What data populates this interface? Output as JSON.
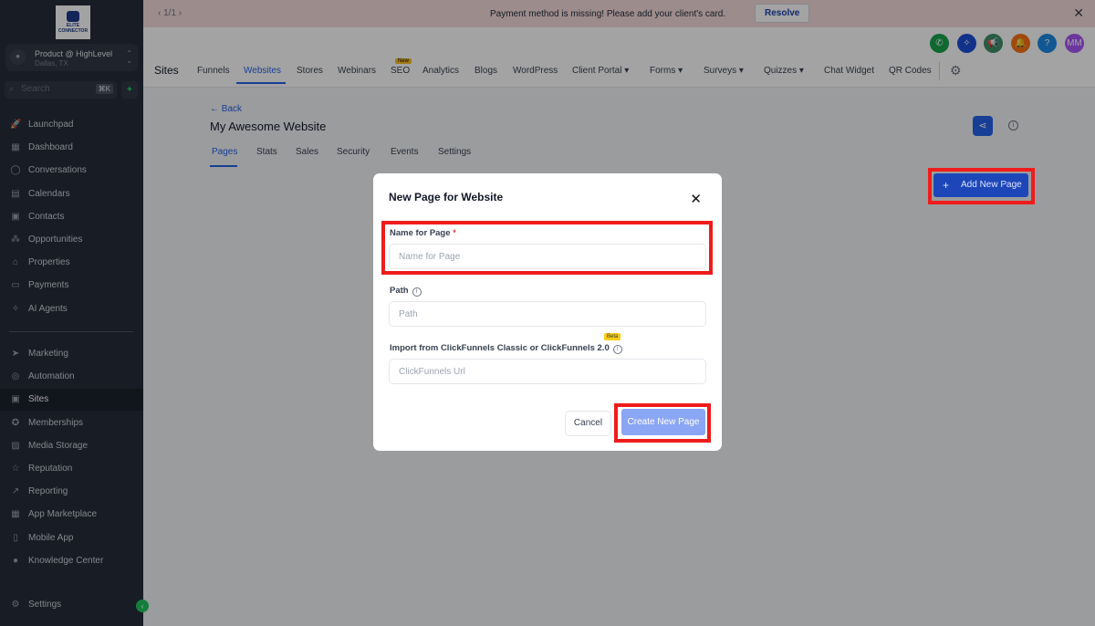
{
  "sidebar": {
    "logo_text": "ELITE CONNECTOR",
    "account_name": "Product @ HighLevel",
    "account_location": "Dallas, TX",
    "search_placeholder": "Search",
    "search_shortcut": "⌘K",
    "items": [
      {
        "label": "Launchpad",
        "icon": "rocket-icon"
      },
      {
        "label": "Dashboard",
        "icon": "grid-icon"
      },
      {
        "label": "Conversations",
        "icon": "chat-icon"
      },
      {
        "label": "Calendars",
        "icon": "calendar-icon"
      },
      {
        "label": "Contacts",
        "icon": "contacts-icon"
      },
      {
        "label": "Opportunities",
        "icon": "funnel-icon"
      },
      {
        "label": "Properties",
        "icon": "home-icon"
      },
      {
        "label": "Payments",
        "icon": "card-icon"
      },
      {
        "label": "AI Agents",
        "icon": "sparkle-icon"
      }
    ],
    "items2": [
      {
        "label": "Marketing",
        "icon": "send-icon"
      },
      {
        "label": "Automation",
        "icon": "automation-icon"
      },
      {
        "label": "Sites",
        "icon": "globe-icon",
        "active": true
      },
      {
        "label": "Memberships",
        "icon": "badge-icon"
      },
      {
        "label": "Media Storage",
        "icon": "image-icon"
      },
      {
        "label": "Reputation",
        "icon": "star-icon"
      },
      {
        "label": "Reporting",
        "icon": "chart-icon"
      },
      {
        "label": "App Marketplace",
        "icon": "apps-icon"
      },
      {
        "label": "Mobile App",
        "icon": "phone-icon"
      },
      {
        "label": "Knowledge Center",
        "icon": "info-icon"
      }
    ],
    "settings": "Settings"
  },
  "banner": {
    "pager": "1/1",
    "message": "Payment method is missing! Please add your client's card.",
    "resolve": "Resolve"
  },
  "header": {
    "section": "Sites",
    "tabs": [
      "Funnels",
      "Websites",
      "Stores",
      "Webinars",
      "SEO",
      "Analytics",
      "Blogs",
      "WordPress",
      "Client Portal ▾",
      "Forms ▾",
      "Surveys ▾",
      "Quizzes ▾",
      "Chat Widget",
      "QR Codes"
    ],
    "new_badge": "New",
    "avatar": "MM"
  },
  "page": {
    "back": "← Back",
    "title": "My Awesome Website",
    "tabs": [
      "Pages",
      "Stats",
      "Sales",
      "Security",
      "Events",
      "Settings"
    ],
    "add_button": "Add New Page"
  },
  "modal": {
    "title": "New Page for Website",
    "name_label": "Name for Page",
    "required": "*",
    "name_placeholder": "Name for Page",
    "path_label": "Path",
    "path_placeholder": "Path",
    "import_label": "Import from ClickFunnels Classic or ClickFunnels 2.0",
    "beta": "Beta",
    "import_placeholder": "ClickFunnels Url",
    "cancel": "Cancel",
    "create": "Create New Page"
  }
}
